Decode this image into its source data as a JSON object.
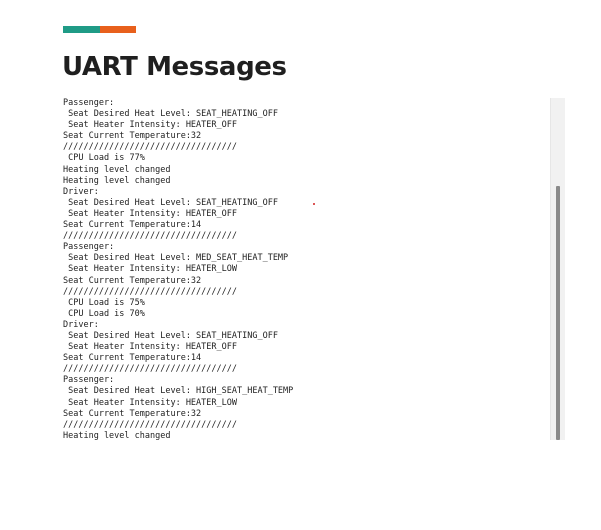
{
  "page": {
    "title": "UART Messages",
    "accent_colors": [
      "#1f9b86",
      "#e8601c"
    ]
  },
  "console": {
    "lines": [
      "Passenger:",
      " Seat Desired Heat Level: SEAT_HEATING_OFF",
      " Seat Heater Intensity: HEATER_OFF",
      "Seat Current Temperature:32",
      "//////////////////////////////////",
      " CPU Load is 77%",
      "Heating level changed",
      "Heating level changed",
      "Driver:",
      " Seat Desired Heat Level: SEAT_HEATING_OFF",
      " Seat Heater Intensity: HEATER_OFF",
      "Seat Current Temperature:14",
      "//////////////////////////////////",
      "Passenger:",
      " Seat Desired Heat Level: MED_SEAT_HEAT_TEMP",
      " Seat Heater Intensity: HEATER_LOW",
      "Seat Current Temperature:32",
      "//////////////////////////////////",
      " CPU Load is 75%",
      " CPU Load is 70%",
      "Driver:",
      " Seat Desired Heat Level: SEAT_HEATING_OFF",
      " Seat Heater Intensity: HEATER_OFF",
      "Seat Current Temperature:14",
      "//////////////////////////////////",
      "Passenger:",
      " Seat Desired Heat Level: HIGH_SEAT_HEAT_TEMP",
      " Seat Heater Intensity: HEATER_LOW",
      "Seat Current Temperature:32",
      "//////////////////////////////////",
      "Heating level changed"
    ],
    "scroll_position": 0.26
  }
}
